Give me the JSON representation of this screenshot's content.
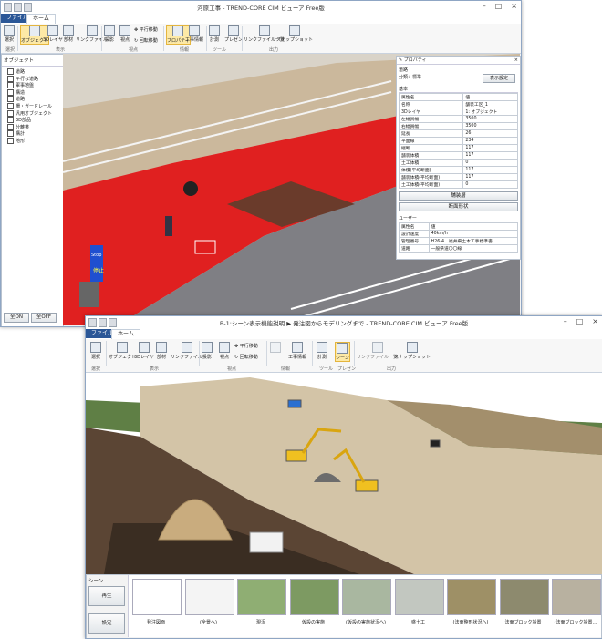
{
  "back_window": {
    "title": "河原工事 - TREND-CORE CIM ビューア Free版",
    "tabs": {
      "file": "ファイル",
      "home": "ホーム"
    },
    "ribbon": {
      "select": "選択",
      "object": "オブジェクト",
      "layer3d": "3Dレイヤ",
      "member": "部材",
      "linkfile": "リンクファイル",
      "projection": "投影",
      "viewpoint": "視点",
      "pan": "平行移動",
      "rotate": "回転移動",
      "property": "プロパティ",
      "construction": "工事情報",
      "measure": "計測",
      "present": "プレゼン",
      "linkfile_list": "リンクファイル一覧",
      "snapshot": "スナップショット",
      "groups": {
        "select": "選択",
        "display": "表示",
        "viewpoint": "視点",
        "info": "情報",
        "tool": "ツール",
        "output": "出力"
      }
    },
    "object_panel": {
      "header": "オブジェクト",
      "items": [
        "道路",
        "平行な道路",
        "軍事地盤",
        "構造",
        "道路",
        "柵・ガードレール",
        "汎用オブジェクト",
        "3D部品",
        "分離帯",
        "構計",
        "地形"
      ],
      "all_on": "全ON",
      "all_off": "全OFF"
    },
    "property_panel": {
      "title": "プロパティ",
      "object_name": "道路",
      "category": "分類：標準",
      "display_settings": "表示設定",
      "basic_header": "基本",
      "col_attr": "属性名",
      "col_value": "値",
      "rows": [
        [
          "名称",
          "舗装工区_1"
        ],
        [
          "3Dレイヤ",
          "1: オブジェクト"
        ],
        [
          "左幅員幅",
          "3500"
        ],
        [
          "右幅員幅",
          "3500"
        ],
        [
          "延長",
          "26"
        ],
        [
          "平面線",
          "234"
        ],
        [
          "縦断",
          "117"
        ],
        [
          "舗装体積",
          "117"
        ],
        [
          "土工体積",
          "0"
        ],
        [
          "体積(平均断面)",
          "117"
        ],
        [
          "舗装体積(平均断面)",
          "117"
        ],
        [
          "土工体積(平均断面)",
          "0"
        ]
      ],
      "btn_pavement": "舗装層",
      "btn_section": "断面形状",
      "user_header": "ユーザー",
      "user_rows": [
        [
          "属性名",
          "値"
        ],
        [
          "設計速度",
          "40km/h"
        ],
        [
          "管理番号",
          "H26-4　福井県土木工事標準書"
        ],
        [
          "道路",
          "一般県道〇〇線"
        ]
      ]
    },
    "scene_texts": {
      "sign": "停止",
      "stop": "Stop"
    }
  },
  "front_window": {
    "title": "B-1:シーン表示機能説明 ▶ 発注図からモデリングまで - TREND-CORE CIM ビューア Free版",
    "tabs": {
      "file": "ファイル",
      "home": "ホーム"
    },
    "ribbon": {
      "select": "選択",
      "object": "オブジェクト",
      "layer3d": "3Dレイヤ",
      "member": "部材",
      "linkfile": "リンクファイル",
      "projection": "投影",
      "viewpoint": "視点",
      "pan": "平行移動",
      "rotate": "回転移動",
      "construction": "工事情報",
      "measure": "計測",
      "scene": "シーン",
      "linkfile_list": "リンクファイル一覧",
      "snapshot": "スナップショット",
      "groups": {
        "select": "選択",
        "display": "表示",
        "viewpoint": "視点",
        "info": "情報",
        "tool": "ツール",
        "present": "プレゼン",
        "output": "出力"
      }
    },
    "scene_panel": {
      "header": "シーン",
      "play": "再生",
      "settings": "設定",
      "thumbs": [
        "発注図面",
        "(全景へ)",
        "現況",
        "仮設の実施",
        "(仮設の実施状況へ)",
        "盛土工",
        "(法面整形状況へ)",
        "法面ブロック設置",
        "(法面ブロック設置…"
      ]
    }
  }
}
